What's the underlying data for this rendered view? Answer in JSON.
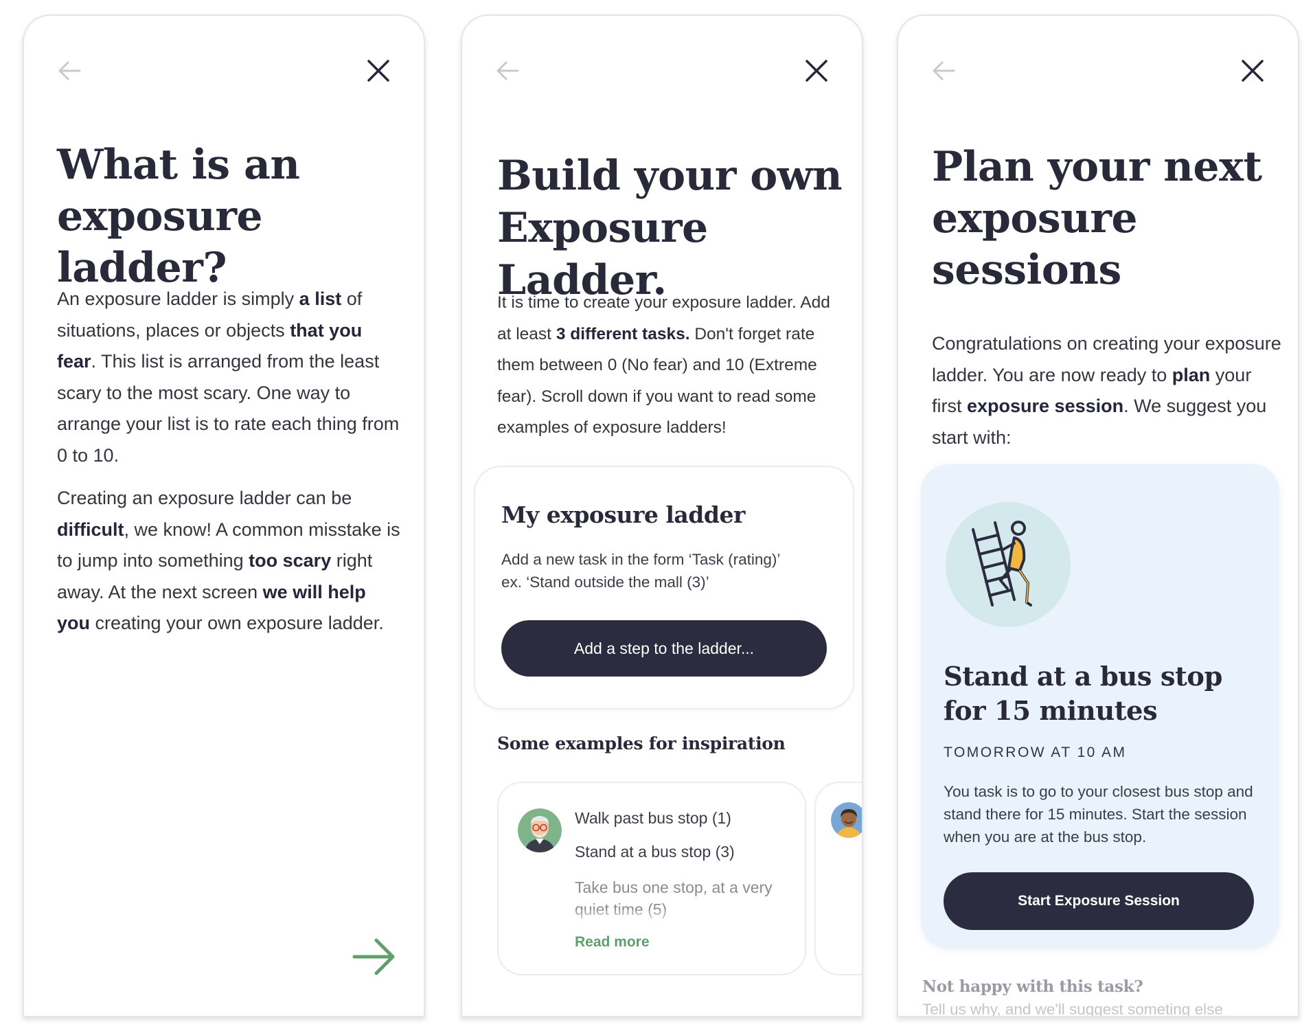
{
  "colors": {
    "primary_dark": "#2b2c40",
    "accent_green": "#5f9f6e",
    "card_blue": "#eaf2fb",
    "illustration_bg": "#d4e9eb",
    "illustration_figure": "#f0b840"
  },
  "screen1": {
    "back_icon": "arrow-left-icon",
    "close_icon": "close-icon",
    "title": "What is an exposure ladder?",
    "p1": {
      "t1": "An exposure ladder is simply ",
      "b1": "a list",
      "t2": " of situations, places or objects ",
      "b2": "that you fear",
      "t3": ". This list is arranged from the least scary to the most scary. One way to arrange your list is to rate each thing from 0 to 10."
    },
    "p2": {
      "t1": "Creating an exposure ladder can be ",
      "b1": "difficult",
      "t2": ", we know! A common misstake is to jump into something ",
      "b2": "too scary",
      "t3": " right away. At the next screen ",
      "b3": "we will help you",
      "t4": " creating your own exposure ladder."
    },
    "next_icon": "arrow-right-icon"
  },
  "screen2": {
    "back_icon": "arrow-left-icon",
    "close_icon": "close-icon",
    "title": "Build your own Exposure Ladder.",
    "p1": {
      "t1": "It is time to create your exposure ladder. Add at least ",
      "b1": "3 different tasks.",
      "t2": " Don't forget rate them between 0 (No fear) and 10 (Extreme fear). Scroll down if you want to read some examples of exposure ladders!"
    },
    "ladder_card": {
      "title": "My exposure ladder",
      "hint_line1": "Add a new task in the form ‘Task (rating)’",
      "hint_line2": "ex. ‘Stand outside the mall (3)’",
      "button": "Add a step to the ladder..."
    },
    "examples_heading": "Some examples for inspiration",
    "example": {
      "steps": [
        "Walk past bus stop (1)",
        "Stand at a bus stop (3)",
        "Take bus one stop, at a very quiet time (5)"
      ],
      "read_more": "Read more"
    }
  },
  "screen3": {
    "back_icon": "arrow-left-icon",
    "close_icon": "close-icon",
    "title": "Plan your next exposure sessions",
    "p1": {
      "t1": "Congratulations on creating your exposure ladder. You are now ready to ",
      "b1": "plan",
      "t2": " your first ",
      "b2": "exposure session",
      "t3": ". We suggest you start with:"
    },
    "task": {
      "illustration_icon": "ladder-climber-icon",
      "title": "Stand at a bus stop for 15 minutes",
      "time": "TOMORROW AT 10 AM",
      "description": "You task is to go to your closest bus stop and stand there for 15 minutes.  Start the session when you are at the bus stop.",
      "button": "Start Exposure Session"
    },
    "unhappy_title": "Not happy with this task?",
    "unhappy_sub": "Tell us why, and we'll suggest someting else"
  }
}
